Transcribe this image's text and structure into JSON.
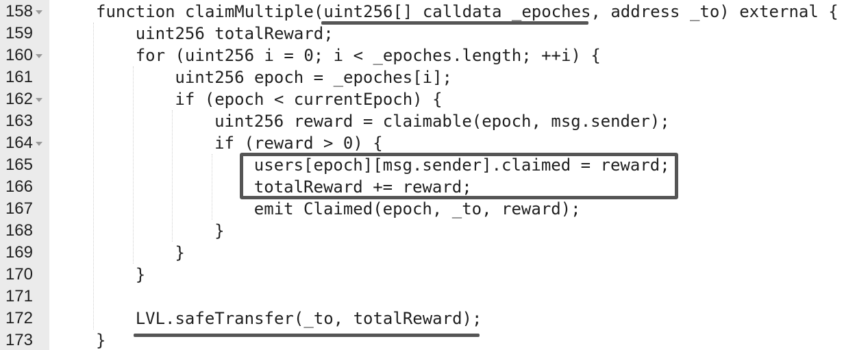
{
  "editor": {
    "lines": [
      {
        "number": "158",
        "fold": true,
        "indent": 0,
        "code": "function claimMultiple(uint256[] calldata _epoches, address _to) external {"
      },
      {
        "number": "159",
        "fold": false,
        "indent": 1,
        "code": "uint256 totalReward;"
      },
      {
        "number": "160",
        "fold": true,
        "indent": 1,
        "code": "for (uint256 i = 0; i < _epoches.length; ++i) {"
      },
      {
        "number": "161",
        "fold": false,
        "indent": 2,
        "code": "uint256 epoch = _epoches[i];"
      },
      {
        "number": "162",
        "fold": true,
        "indent": 2,
        "code": "if (epoch < currentEpoch) {"
      },
      {
        "number": "163",
        "fold": false,
        "indent": 3,
        "code": "uint256 reward = claimable(epoch, msg.sender);"
      },
      {
        "number": "164",
        "fold": true,
        "indent": 3,
        "code": "if (reward > 0) {"
      },
      {
        "number": "165",
        "fold": false,
        "indent": 4,
        "code": "users[epoch][msg.sender].claimed = reward;"
      },
      {
        "number": "166",
        "fold": false,
        "indent": 4,
        "code": "totalReward += reward;"
      },
      {
        "number": "167",
        "fold": false,
        "indent": 4,
        "code": "emit Claimed(epoch, _to, reward);"
      },
      {
        "number": "168",
        "fold": false,
        "indent": 3,
        "code": "}"
      },
      {
        "number": "169",
        "fold": false,
        "indent": 2,
        "code": "}"
      },
      {
        "number": "170",
        "fold": false,
        "indent": 1,
        "code": "}"
      },
      {
        "number": "171",
        "fold": false,
        "indent": 0,
        "code": ""
      },
      {
        "number": "172",
        "fold": false,
        "indent": 1,
        "code": "LVL.safeTransfer(_to, totalReward);"
      },
      {
        "number": "173",
        "fold": false,
        "indent": 0,
        "code": "}"
      }
    ]
  },
  "colors": {
    "gutter": "#ebebeb",
    "text": "#1f1f1f",
    "annotation": "#555555"
  }
}
